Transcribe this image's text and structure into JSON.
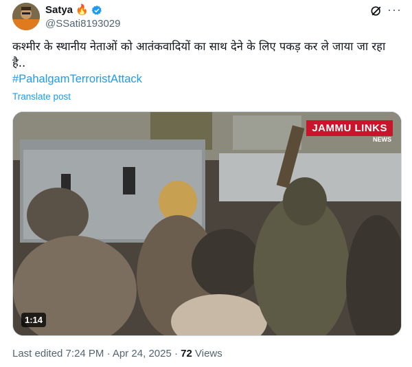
{
  "author": {
    "display_name": "Satya",
    "handle": "@SSati8193029",
    "fire_emoji": "🔥",
    "verified_color": "#1d9bf0"
  },
  "actions": {
    "grok_icon": "grok-icon",
    "more_icon": "more-icon"
  },
  "post": {
    "text": "कश्मीर के स्थानीय नेताओं को आतंकवादियों का साथ देने के लिए पकड़ कर ले जाया जा रहा है..",
    "hashtag": "#PahalgamTerroristAttack",
    "translate_label": "Translate post"
  },
  "video": {
    "channel_logo": "JAMMU LINKS",
    "channel_sub": "NEWS",
    "duration": "1:14"
  },
  "meta": {
    "edited_label": "Last edited 7:24 PM · Apr 24, 2025 · ",
    "views_count": "72",
    "views_label": " Views"
  },
  "colors": {
    "accent": "#1d9bf0",
    "logo_red": "#c7162b",
    "muted": "#536471"
  }
}
